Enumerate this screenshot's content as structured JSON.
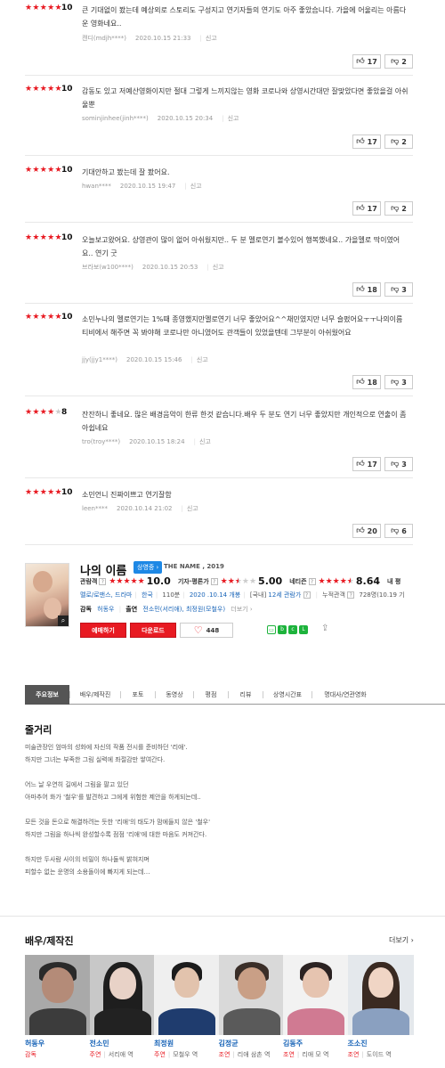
{
  "reviews": [
    {
      "stars": 5,
      "score": "10",
      "text": "큰 기대없이 봤는데 예상외로 스토리도 구성지고 연기자들의 연기도 아주 좋았습니다. 가을에 어울리는 아름다운 영화네요..",
      "user": "캔디(mdjh****)",
      "date": "2020.10.15 21:33",
      "report": "신고",
      "up": "17",
      "down": "2"
    },
    {
      "stars": 5,
      "score": "10",
      "text": "감동도 있고 저예산영화이지만 절대 그렇게 느끼지않는 영화 코로나와 상영시간대만 잘맞았다면 좋았을걸 아쉬울뿐",
      "user": "sominjinhee(jinh****)",
      "date": "2020.10.15 20:34",
      "report": "신고",
      "up": "17",
      "down": "2"
    },
    {
      "stars": 5,
      "score": "10",
      "text": "기대안하고 봤는데 잘 봤어요.",
      "user": "hwan****",
      "date": "2020.10.15 19:47",
      "report": "신고",
      "up": "17",
      "down": "2"
    },
    {
      "stars": 5,
      "score": "10",
      "text": "오늘보고왔어요. 상영관이 많이 없어 아쉬웠지만.. 두 분 멜로연기 볼수있어 행복했네요.. 가을멜로 딱이였어요.. 연기 굿",
      "user": "브라보(w100****)",
      "date": "2020.10.15 20:53",
      "report": "신고",
      "up": "18",
      "down": "3"
    },
    {
      "stars": 5,
      "score": "10",
      "text": "소민누나의 멜로연기는 1%때 종영했지만멜로연기 너무 좋았어요^^채민였지만 너무 슬펐어요ㅜㅜ나의이름 티비에서 해주면 꼭 봐야해 코로나만 아니였어도 관객들이 있었을텐데 그부분이 아쉬웠어요",
      "user": "jjy(jjy1****)",
      "date": "2020.10.15 15:46",
      "report": "신고",
      "up": "18",
      "down": "3"
    },
    {
      "stars": 4,
      "score": "8",
      "text": "잔잔하니 좋네요. 많은 배경음악이 한류 한것 같습니다.배우 두 분도 연기 너무 좋았지만 개인적으로 연출이 좀 아쉽네요",
      "user": "tro(troy****)",
      "date": "2020.10.15 18:24",
      "report": "신고",
      "up": "17",
      "down": "3"
    },
    {
      "stars": 5,
      "score": "10",
      "text": "소민언니 진짜이쁘고 연기잘함",
      "user": "leen****",
      "date": "2020.10.14 21:02",
      "report": "신고",
      "up": "20",
      "down": "6"
    }
  ],
  "movie": {
    "title": "나의 이름",
    "status": "상영중 ›",
    "eng": "THE NAME , 2019",
    "audience_label": "관람객",
    "audience_stars": 5,
    "audience_score": "10.0",
    "critic_label": "기자·평론가",
    "critic_stars": 2.5,
    "critic_score": "5.00",
    "netizen_label": "네티즌",
    "netizen_stars": 4.5,
    "netizen_score": "8.64",
    "my_rating": "내 평",
    "genre": "멜로/로맨스, 드라마",
    "country": "한국",
    "runtime": "110분",
    "release": "2020 .10.14 개봉",
    "grade_prefix": "[국내]",
    "grade": "12세 관람가",
    "cumulative_label": "누적관객",
    "cumulative": "728명(10.19 기",
    "director_label": "감독",
    "director": "허동우",
    "cast_label": "출연",
    "cast": "전소민(서리애), 최정원(모철우)",
    "more": "더보기 ›",
    "reserve": "예매하기",
    "download": "다운로드",
    "likes": "448"
  },
  "tabs": [
    "주요정보",
    "배우/제작진",
    "포토",
    "동영상",
    "평점",
    "리뷰",
    "상영시간표",
    "명대사/연관영화"
  ],
  "synopsis": {
    "title": "줄거리",
    "paragraphs": [
      [
        "미술관장인 엄마의 성화에 자신의 작품 전시를 준비하던 '리애'.",
        "하지만 그녀는 부족한 그림 실력에 좌절감만 쌓여간다."
      ],
      [
        "어느 날 우연히 길에서 그림을 팔고 있던",
        "아마추어 화가 '철우'를 발견하고 그에게 위험한 제안을 하게되는데.."
      ],
      [
        "모든 것을 돈으로 해결하려는 듯한 '리애'의 태도가 맘에들지 않은 '철우'",
        "하지만 그림을 하나씩 완성할수록 점점 '리애'에 대한 마음도 커져간다."
      ],
      [
        "하지만 두사람 사이의 비밀이 하나둘씩 밝혀지며",
        "피할수 없는 운명의 소용돌이에 빠지게 되는데…"
      ]
    ]
  },
  "cast_section": {
    "title": "배우/제작진",
    "more": "더보기 ›",
    "people": [
      {
        "name": "허동우",
        "role": "감독",
        "character": ""
      },
      {
        "name": "전소민",
        "role": "주연",
        "character": "서리애 역"
      },
      {
        "name": "최정원",
        "role": "주연",
        "character": "모철우 역"
      },
      {
        "name": "김정균",
        "role": "조연",
        "character": "리애 삼촌 역"
      },
      {
        "name": "김동주",
        "role": "조연",
        "character": "리애 모 역"
      },
      {
        "name": "조소진",
        "role": "조연",
        "character": "도이드 역"
      }
    ]
  },
  "colors": {
    "accent": "#e81a22",
    "link": "#1a65b8",
    "badge": "#1e88e5"
  }
}
